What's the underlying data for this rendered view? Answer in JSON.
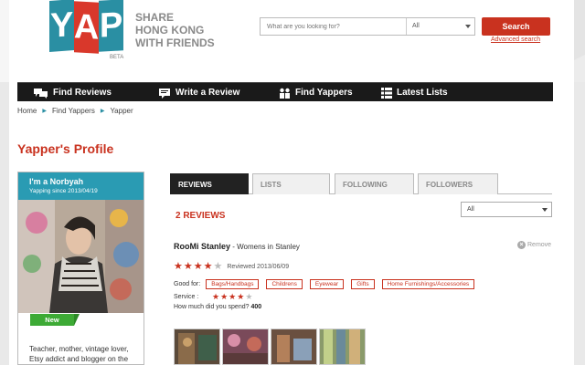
{
  "header": {
    "logo_text": "YAP",
    "logo_letters": [
      "Y",
      "A",
      "P"
    ],
    "beta": "BETA",
    "tagline": [
      "SHARE",
      "HONG KONG",
      "WITH FRIENDS"
    ],
    "search_placeholder": "What are you looking for?",
    "search_scope": "All",
    "search_button": "Search",
    "advanced_search": "Advanced search"
  },
  "nav": {
    "items": [
      {
        "label": "Find Reviews",
        "icon": "chat-bubbles-icon"
      },
      {
        "label": "Write a Review",
        "icon": "speech-bubble-icon"
      },
      {
        "label": "Find Yappers",
        "icon": "people-icon"
      },
      {
        "label": "Latest Lists",
        "icon": "list-icon"
      }
    ]
  },
  "breadcrumb": [
    "Home",
    "Find Yappers",
    "Yapper"
  ],
  "page_title": "Yapper's Profile",
  "profile": {
    "name": "I'm a Norbyah",
    "since": "Yapping since 2013/04/19",
    "badge": "New",
    "bio": "Teacher, mother, vintage lover, Etsy addict and blogger on the"
  },
  "tabs": [
    {
      "label": "REVIEWS",
      "active": true
    },
    {
      "label": "LISTS",
      "active": false
    },
    {
      "label": "FOLLOWING",
      "active": false
    },
    {
      "label": "FOLLOWERS",
      "active": false
    }
  ],
  "reviews_count": "2 REVIEWS",
  "sort_filter": "All",
  "review": {
    "shop": "RooMi Stanley",
    "category": "- Womens in Stanley",
    "remove": "Remove",
    "rating": 4,
    "rating_max": 5,
    "reviewed_date": "Reviewed 2013/06/09",
    "good_for_label": "Good for:",
    "good_for_tags": [
      "Bags/Handbags",
      "Childrens",
      "Eyewear",
      "Gifts",
      "Home Furnishings/Accessories"
    ],
    "service_label": "Service :",
    "service_rating": 4,
    "spend_label": "How much did you spend?",
    "spend_value": "400"
  },
  "colors": {
    "brand_red": "#c9321f",
    "brand_teal": "#2a9bb3",
    "nav_bg": "#1a1a1a",
    "badge_green": "#3daa35"
  }
}
